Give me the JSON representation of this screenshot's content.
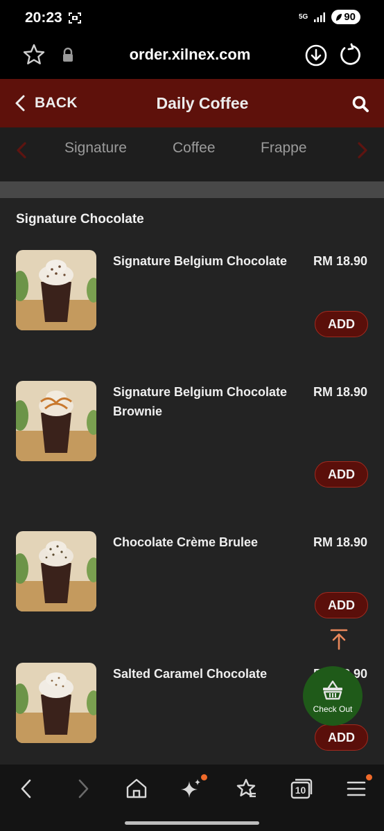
{
  "status_bar": {
    "time": "20:23",
    "network": "5G",
    "battery": "90",
    "icons": [
      "screenshot-icon",
      "signal-icon",
      "battery-icon"
    ]
  },
  "browser": {
    "url": "order.xilnex.com",
    "icons": [
      "bookmark-star-icon",
      "lock-icon",
      "download-icon",
      "reload-icon"
    ]
  },
  "header": {
    "back_label": "BACK",
    "title": "Daily Coffee",
    "icons": [
      "chevron-left-icon",
      "search-icon"
    ],
    "color": "#5e110b"
  },
  "categories": {
    "tabs": [
      "Signature",
      "Coffee",
      "Frappe"
    ],
    "icons": [
      "chevron-left-icon",
      "chevron-right-icon"
    ]
  },
  "section": {
    "title": "Signature Chocolate"
  },
  "products": [
    {
      "name": "Signature Belgium Chocolate",
      "price": "RM 18.90",
      "add_label": "ADD"
    },
    {
      "name": "Signature Belgium Chocolate Brownie",
      "price": "RM 18.90",
      "add_label": "ADD"
    },
    {
      "name": "Chocolate Crème Brulee",
      "price": "RM 18.90",
      "add_label": "ADD"
    },
    {
      "name": "Salted Caramel Chocolate",
      "price": "RM 18.90",
      "add_label": "ADD"
    }
  ],
  "checkout": {
    "label": "Check Out",
    "color": "#1f5a19"
  },
  "bottom_nav": {
    "tabs_count": "10",
    "icons": [
      "back-icon",
      "forward-icon",
      "home-icon",
      "sparkle-icon",
      "favorites-icon",
      "tabs-icon",
      "menu-icon"
    ],
    "badge_color": "#f06a2a"
  },
  "colors": {
    "add_button": "#5a0f0a",
    "scroll_top_arrow": "#e8875a"
  }
}
